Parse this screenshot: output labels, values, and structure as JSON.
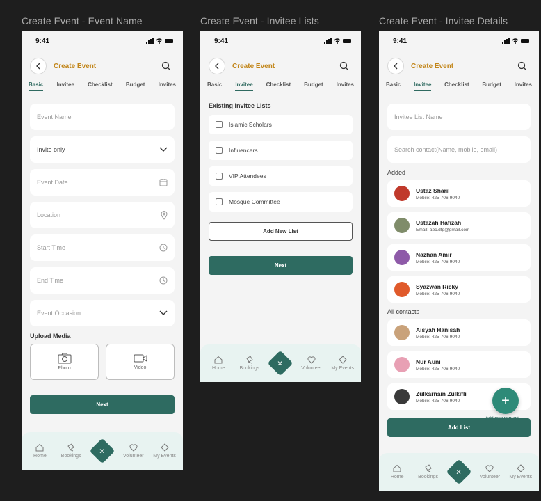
{
  "frames": [
    {
      "title": "Create Event - Event Name"
    },
    {
      "title": "Create Event - Invitee Lists"
    },
    {
      "title": "Create Event - Invitee Details"
    }
  ],
  "status": {
    "time": "9:41"
  },
  "header": {
    "title": "Create Event",
    "back_icon": "chevron-left-icon",
    "search_icon": "search-icon"
  },
  "tabs": [
    "Basic",
    "Invitee",
    "Checklist",
    "Budget",
    "Invites"
  ],
  "screen1": {
    "fields": [
      {
        "label": "Event Name",
        "icon": ""
      },
      {
        "label": "Invite only",
        "icon": "chevron-down-icon"
      },
      {
        "label": "Event Date",
        "icon": "calendar-icon"
      },
      {
        "label": "Location",
        "icon": "location-pin-icon"
      },
      {
        "label": "Start Time",
        "icon": "clock-icon"
      },
      {
        "label": "End Time",
        "icon": "clock-icon"
      },
      {
        "label": "Event Occasion",
        "icon": "chevron-down-icon"
      }
    ],
    "upload_label": "Upload Media",
    "upload_photo": "Photo",
    "upload_video": "Video",
    "next": "Next"
  },
  "screen2": {
    "section_label": "Existing Invitee Lists",
    "lists": [
      "Islamic Scholars",
      "Influencers",
      "VIP Attendees",
      "Mosque Committee"
    ],
    "add_new_list": "Add New List",
    "next": "Next"
  },
  "screen3": {
    "list_name_placeholder": "Invitee List Name",
    "search_placeholder": "Search contact(Name, mobile, email)",
    "added_label": "Added",
    "added": [
      {
        "name": "Ustaz Sharil",
        "sub": "Mobile: 425-706-9040",
        "color": "#c0392b"
      },
      {
        "name": "Ustazah Hafizah",
        "sub": "Email: abc.dfg@gmail.com",
        "color": "#7f8c6a"
      },
      {
        "name": "Nazhan Amir",
        "sub": "Mobile: 425-706-9040",
        "color": "#8e5aa8"
      },
      {
        "name": "Syazwan Ricky",
        "sub": "Mobile: 425-706-9040",
        "color": "#e05a2b"
      }
    ],
    "all_label": "All contacts",
    "all": [
      {
        "name": "Aisyah Hanisah",
        "sub": "Mobile: 425-706-9040",
        "color": "#c9a27a"
      },
      {
        "name": "Nur Auni",
        "sub": "Mobile: 425-706-9040",
        "color": "#e8a0b4"
      },
      {
        "name": "Zulkarnain Zulkifli",
        "sub": "Mobile: 425-706-9040",
        "color": "#3a3a3a"
      }
    ],
    "fab_label": "Add new contact",
    "add_list": "Add List"
  },
  "nav": {
    "home": "Home",
    "bookings": "Bookings",
    "volunteer": "Volunteer",
    "my_events": "My Events"
  },
  "colors": {
    "primary": "#2e6b61",
    "accent": "#c2861a",
    "nav_bg": "#e8f3f1"
  }
}
